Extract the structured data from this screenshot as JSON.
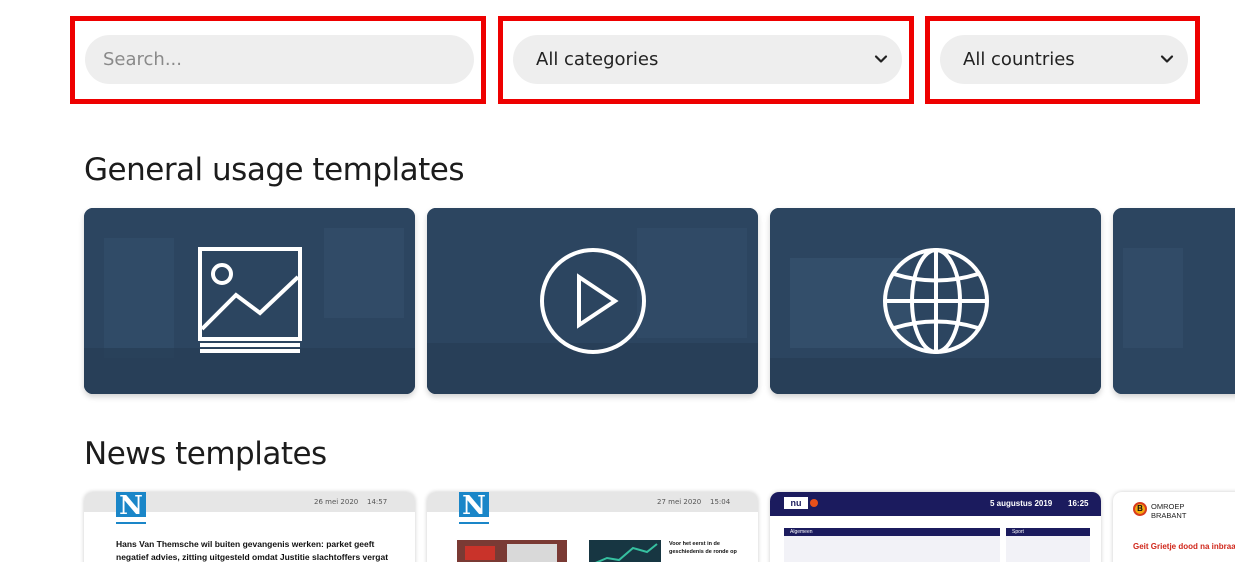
{
  "filters": {
    "search_placeholder": "Search...",
    "category_value": "All categories",
    "country_value": "All countries",
    "highlight_color": "#ee0000"
  },
  "sections": {
    "general_title": "General usage templates",
    "news_title": "News templates"
  },
  "general_cards": [
    {
      "icon": "image-icon"
    },
    {
      "icon": "play-icon"
    },
    {
      "icon": "globe-icon"
    },
    {
      "icon": "partial-card"
    }
  ],
  "news_cards": [
    {
      "date": "26 mei 2020",
      "time": "14:57",
      "headline": "Hans Van Themsche wil buiten gevangenis werken: parket geeft negatief advies, zitting uitgesteld omdat Justitie slachtoffers vergat"
    },
    {
      "date": "27 mei 2020",
      "time": "15:04",
      "headline": "Voor het eerst in de geschiedenis de ronde op"
    },
    {
      "date": "5 augustus 2019",
      "time": "16:25",
      "panel_left": "Algemeen",
      "panel_right": "Sport"
    },
    {
      "brand": "OMROEP BRABANT",
      "brand_line1": "OMROEP",
      "brand_line2": "BRABANT",
      "headline": "Geit Grietje dood na inbraak i"
    }
  ],
  "colors": {
    "card_bg": "#2c4560",
    "news_blue": "#1b1b5e",
    "brand_red": "#d0261a"
  }
}
